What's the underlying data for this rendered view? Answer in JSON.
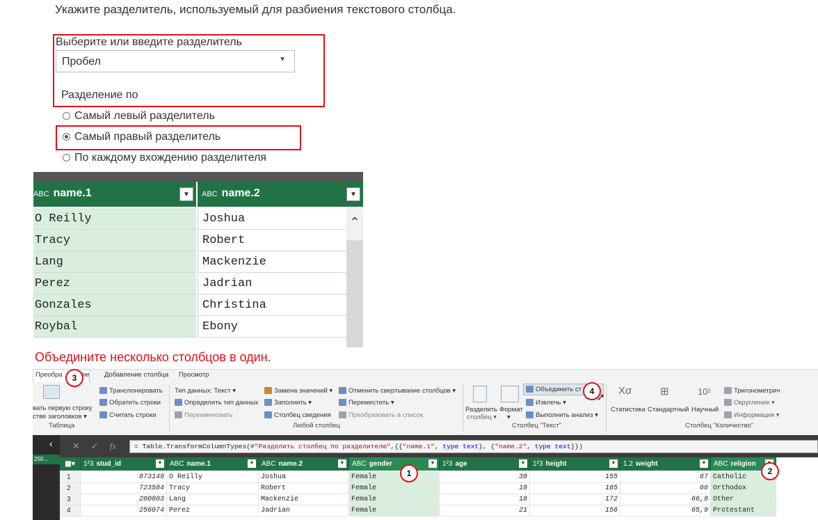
{
  "instruction": "Укажите разделитель, используемый для разбиения текстового столбца.",
  "delimiter": {
    "label": "Выберите или введите разделитель",
    "selected": "Пробел"
  },
  "split_at": {
    "label": "Разделение по",
    "options": [
      {
        "label": "Самый левый разделитель",
        "checked": false
      },
      {
        "label": "Самый правый разделитель",
        "checked": true
      },
      {
        "label": "По каждому вхождению разделителя",
        "checked": false
      }
    ]
  },
  "preview": {
    "columns": [
      "name.1",
      "name.2"
    ],
    "type_icon": "ABC",
    "rows": [
      [
        "O Reilly",
        "Joshua"
      ],
      [
        "Tracy",
        "Robert"
      ],
      [
        "Lang",
        "Mackenzie"
      ],
      [
        "Perez",
        "Jadrian"
      ],
      [
        "Gonzales",
        "Christina"
      ],
      [
        "Roybal",
        "Ebony"
      ]
    ]
  },
  "caption": "Объедините несколько столбцов в один.",
  "ribbon": {
    "tabs": [
      "Преобра",
      "ие",
      "Добавление столбца",
      "Просмотр"
    ],
    "table_group": {
      "use_first_row": "вать первую строку",
      "as_headers": "стве заголовков",
      "transpose": "Транспонировать",
      "reverse_rows": "Обратить строки",
      "count_rows": "Считать строки",
      "name": "Таблица"
    },
    "any_column": {
      "data_type": "Тип данных: Текст",
      "detect_type": "Определить тип данных",
      "rename": "Переименовать",
      "replace_values": "Замена значений",
      "fill": "Заполнить",
      "pivot": "Столбец сведения",
      "unpivot": "Отменить свертывание столбцов",
      "move": "Переместить",
      "to_list": "Преобразовать в список",
      "name": "Любой столбец"
    },
    "text_column": {
      "split": "Разделить",
      "split2": "столбец",
      "format": "Формат",
      "merge": "Объединить ст",
      "extract": "Извлечь",
      "parse": "Выполнить анализ",
      "name": "Столбец \"Текст\""
    },
    "number_column": {
      "statistics": "Статистика",
      "standard": "Стандартный",
      "scientific": "Научный",
      "trig": "Тригонометрич",
      "rounding": "Округление",
      "info": "Информация",
      "name": "Столбец \"Количество\""
    }
  },
  "left_pane": {
    "query": "250..."
  },
  "formula": {
    "p1": "= Table.TransformColumnTypes(#",
    "s1": "\"Разделить столбец по разделителю\"",
    "p2": ",{{",
    "s2": "\"name.1\"",
    "p3": ", ",
    "k1": "type",
    "p4": " ",
    "k2": "text",
    "p5": "}, {",
    "s3": "\"name.2\"",
    "p6": ", ",
    "k3": "type",
    "p7": " ",
    "k4": "text",
    "p8": "}})"
  },
  "grid": {
    "columns": [
      {
        "type": "1²3",
        "name": "stud_id"
      },
      {
        "type": "ABC",
        "name": "name.1"
      },
      {
        "type": "ABC",
        "name": "name.2"
      },
      {
        "type": "ABC",
        "name": "gender"
      },
      {
        "type": "1²3",
        "name": "age"
      },
      {
        "type": "1²3",
        "name": "height"
      },
      {
        "type": "1.2",
        "name": "weight"
      },
      {
        "type": "ABC",
        "name": "religion"
      }
    ],
    "rows": [
      [
        "1",
        "873149",
        "O Reilly",
        "Joshua",
        "Female",
        "38",
        "155",
        "67",
        "Catholic"
      ],
      [
        "2",
        "723584",
        "Tracy",
        "Robert",
        "Female",
        "18",
        "165",
        "66",
        "Orthodox"
      ],
      [
        "3",
        "200803",
        "Lang",
        "Mackenzie",
        "Female",
        "18",
        "172",
        "66,8",
        "Other"
      ],
      [
        "4",
        "256074",
        "Perez",
        "Jadrian",
        "Female",
        "21",
        "156",
        "65,9",
        "Protestant"
      ]
    ]
  },
  "badges": [
    "1",
    "2",
    "3",
    "4"
  ],
  "colors": {
    "accent_green": "#217346",
    "annotation_red": "#e0101a"
  }
}
